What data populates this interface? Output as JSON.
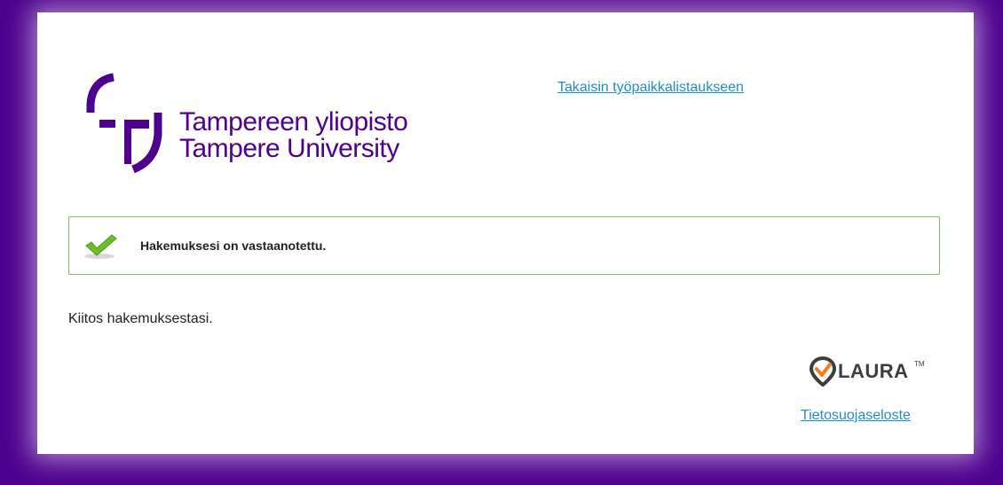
{
  "header": {
    "logo_line1": "Tampereen yliopisto",
    "logo_line2": "Tampere University",
    "back_link": "Takaisin työpaikkalistaukseen"
  },
  "alert": {
    "icon": "checkmark-icon",
    "message": "Hakemuksesi on vastaanotettu."
  },
  "body": {
    "thanks": "Kiitos hakemuksestasi."
  },
  "footer": {
    "brand": "LAURA",
    "trademark": "TM",
    "privacy_link": "Tietosuojaseloste"
  },
  "colors": {
    "background": "#4e008e",
    "brand": "#4e008e",
    "link": "#1f8fc9",
    "success_border": "#7cc35b",
    "laura_accent": "#f08020"
  }
}
